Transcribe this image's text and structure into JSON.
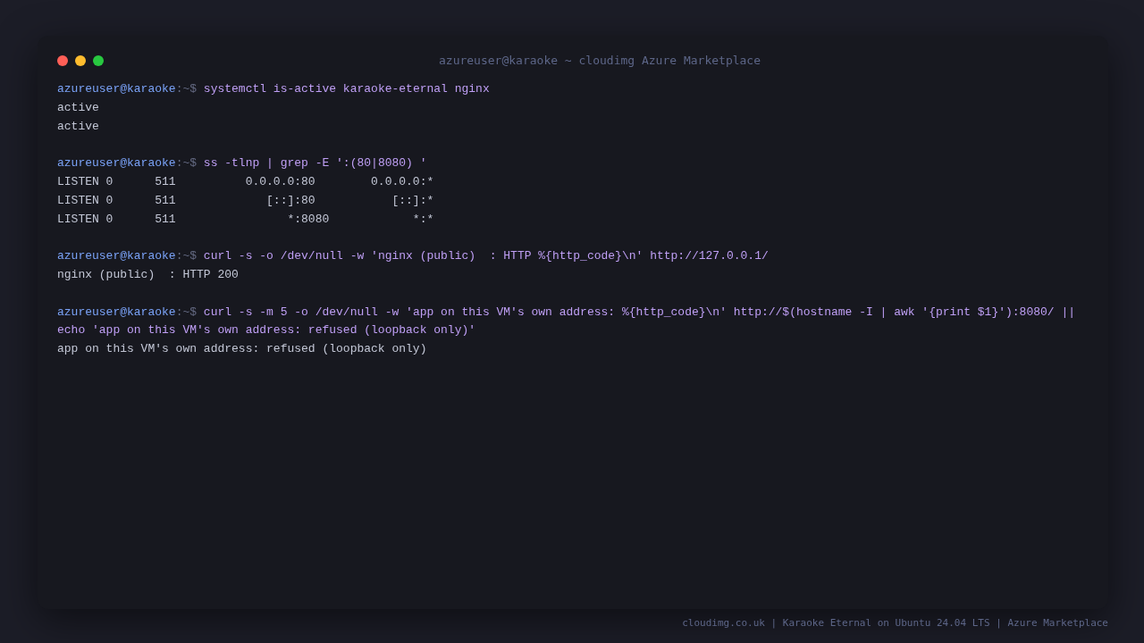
{
  "window": {
    "title": "azureuser@karaoke ~ cloudimg Azure Marketplace"
  },
  "terminal": {
    "entries": [
      {
        "prompt": {
          "user_host": "azureuser@karaoke",
          "path": ":~$"
        },
        "command": "systemctl is-active karaoke-eternal nginx",
        "output": [
          "active",
          "active"
        ]
      },
      {
        "prompt": {
          "user_host": "azureuser@karaoke",
          "path": ":~$"
        },
        "command": "ss -tlnp | grep -E ':(80|8080) '",
        "output": [
          "LISTEN 0      511          0.0.0.0:80        0.0.0.0:*",
          "LISTEN 0      511             [::]:80           [::]:*",
          "LISTEN 0      511                *:8080            *:*"
        ]
      },
      {
        "prompt": {
          "user_host": "azureuser@karaoke",
          "path": ":~$"
        },
        "command": "curl -s -o /dev/null -w 'nginx (public)  : HTTP %{http_code}\\n' http://127.0.0.1/",
        "output": [
          "nginx (public)  : HTTP 200"
        ]
      },
      {
        "prompt": {
          "user_host": "azureuser@karaoke",
          "path": ":~$"
        },
        "command": "curl -s -m 5 -o /dev/null -w 'app on this VM's own address: %{http_code}\\n' http://$(hostname -I | awk '{print $1}'):8080/ || echo 'app on this VM's own address: refused (loopback only)'",
        "output": [
          "app on this VM's own address: refused (loopback only)"
        ]
      }
    ]
  },
  "footer": "cloudimg.co.uk | Karaoke Eternal on Ubuntu 24.04 LTS | Azure Marketplace"
}
